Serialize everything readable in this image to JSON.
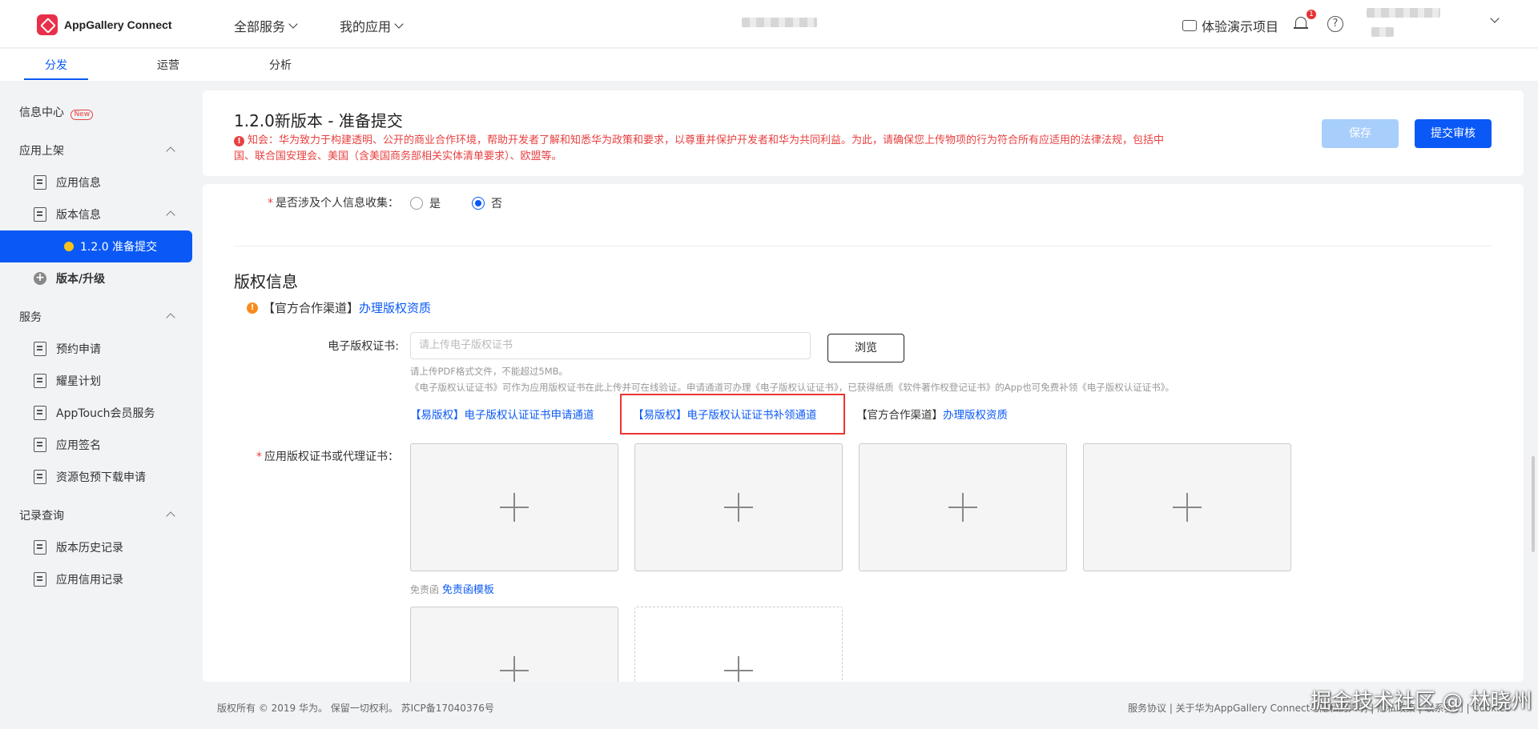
{
  "topbar": {
    "logo_text": "AppGallery Connect",
    "nav_all_services": "全部服务",
    "nav_my_apps": "我的应用",
    "demo_project": "体验演示项目",
    "notification_count": "1",
    "help_glyph": "?"
  },
  "subtabs": {
    "distribute": "分发",
    "operate": "运营",
    "analyze": "分析"
  },
  "sidebar": {
    "info_center": "信息中心",
    "new_badge": "New",
    "app_listing": "应用上架",
    "app_info": "应用信息",
    "version_info": "版本信息",
    "active_version": "1.2.0 准备提交",
    "version_upgrade": "版本/升级",
    "services": "服务",
    "reservation": "预约申请",
    "star_plan": "耀星计划",
    "apptouch": "AppTouch会员服务",
    "app_signing": "应用签名",
    "resource_download": "资源包预下载申请",
    "records": "记录查询",
    "version_history": "版本历史记录",
    "credit_records": "应用信用记录"
  },
  "header": {
    "title": "1.2.0新版本 - 准备提交",
    "notice": "知会：华为致力于构建透明、公开的商业合作环境，帮助开发者了解和知悉华为政策和要求，以尊重并保护开发者和华为共同利益。为此，请确保您上传物项的行为符合所有应适用的法律法规，包括中国、联合国安理会、美国（含美国商务部相关实体清单要求）、欧盟等。",
    "save": "保存",
    "submit": "提交审核"
  },
  "form": {
    "personal_info_label": "是否涉及个人信息收集：",
    "radio_yes": "是",
    "radio_no": "否",
    "selected": "否",
    "copyright_title": "版权信息",
    "official_prefix": "【官方合作渠道】",
    "official_link": "办理版权资质",
    "ecert_label": "电子版权证书:",
    "ecert_placeholder": "请上传电子版权证书",
    "browse": "浏览",
    "hint1": "请上传PDF格式文件，不能超过5MB。",
    "hint2": "《电子版权认证证书》可作为应用版权证书在此上传并可在线验证。申请通道可办理《电子版权认证证书》，已获得纸质《软件著作权登记证书》的App也可免费补领《电子版权认证证书》。",
    "channel_apply": "【易版权】电子版权认证证书申请通道",
    "channel_reissue": "【易版权】电子版权认证证书补领通道",
    "channel_official_prefix": "【官方合作渠道】",
    "channel_official_link": "办理版权资质",
    "cert_label": "应用版权证书或代理证书：",
    "disclaimer_prefix": "免责函",
    "disclaimer_link": "免责函模板"
  },
  "footer": {
    "copyright": "版权所有 © 2019 华为。 保留一切权利。 苏ICP备17040376号",
    "links": "服务协议 | 关于华为AppGallery Connect与隐私的声明 | 隐私政策 | 联系我们 | Cookies"
  },
  "watermark": "掘金技术社区 @ 林晓州",
  "colors": {
    "accent": "#0a59f7",
    "danger": "#e84040",
    "warning": "#f98b1c"
  }
}
